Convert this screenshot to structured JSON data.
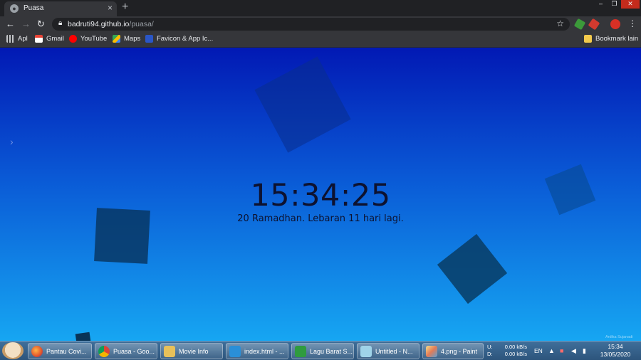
{
  "browser": {
    "tab_title": "Puasa",
    "favicon_glyph": "●",
    "url_host": "badruti94.github.io",
    "url_path": "/puasa/",
    "bookmarks": [
      {
        "label": "Apl",
        "icon": "apps-icon"
      },
      {
        "label": "Gmail",
        "icon": "gmail-icon"
      },
      {
        "label": "YouTube",
        "icon": "youtube-icon"
      },
      {
        "label": "Maps",
        "icon": "maps-icon"
      },
      {
        "label": "Favicon & App Ic...",
        "icon": "favicon-generator-icon"
      }
    ],
    "other_bookmarks": "Bookmark lain"
  },
  "page": {
    "clock": "15:34:25",
    "subtitle": "20 Ramadhan. Lebaran 11 hari lagi."
  },
  "taskbar": {
    "apps": [
      {
        "label": "Pantau Covi...",
        "icon": "firefox-icon"
      },
      {
        "label": "Puasa - Goo...",
        "icon": "chrome-icon"
      },
      {
        "label": "Movie Info",
        "icon": "folder-icon"
      },
      {
        "label": "index.html - ...",
        "icon": "vscode-icon"
      },
      {
        "label": "Lagu Barat S...",
        "icon": "media-player-icon"
      },
      {
        "label": "Untitled - N...",
        "icon": "notepad-icon"
      },
      {
        "label": "4.png - Paint",
        "icon": "paint-icon"
      }
    ],
    "net_up_label": "U:",
    "net_up": "0.00 kB/s",
    "net_down_label": "D:",
    "net_down": "0.00 kB/s",
    "language": "EN",
    "time": "15:34",
    "date": "13/05/2020",
    "watermark": "Ardika Sujanadi"
  },
  "colors": {
    "page_top": "#0219b4",
    "page_bottom": "#16a6f2",
    "square": "#072850"
  }
}
